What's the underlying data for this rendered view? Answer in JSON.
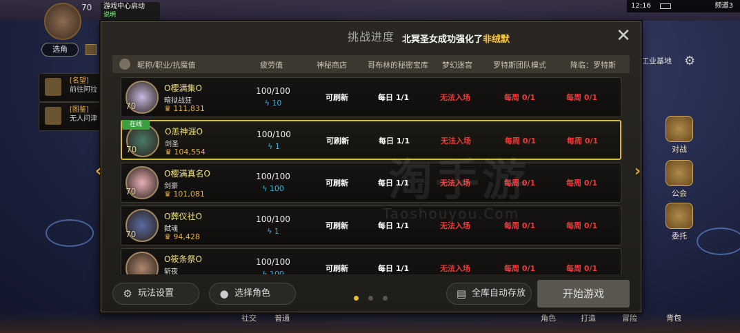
{
  "background": {
    "level": "70",
    "notice_title": "游戏中心启动",
    "notice_sub": "说明",
    "select_label": "选角",
    "side_items": [
      {
        "title": "[名望]",
        "desc": "前往阿拉"
      },
      {
        "title": "[图鉴]",
        "desc": "无人问津"
      }
    ],
    "status": {
      "time": "12:16",
      "channel": "频道3"
    },
    "area_label": "工业基地",
    "right_buttons": [
      "对战",
      "公会",
      "委托"
    ],
    "bottom_labels": [
      "社交",
      "普通",
      "角色",
      "打造",
      "冒险",
      "背包"
    ]
  },
  "modal": {
    "title": "挑战进度",
    "announcement_prefix": "北冥圣女成功强化了",
    "announcement_highlight": "非绒默",
    "columns": [
      "昵称/职业/抗魔值",
      "疲劳值",
      "神秘商店",
      "哥布林的秘密宝库",
      "梦幻迷宫",
      "罗特斯团队模式",
      "降临：罗特斯"
    ],
    "online_badge": "在线",
    "characters": [
      {
        "name": "O樱满集O",
        "job": "暗狱战狂",
        "power": "111,831",
        "level": "70",
        "fatigue": "100/100",
        "fatigue_bonus": "10",
        "shop": "可刷新",
        "goblin": "每日 1/1",
        "maze": "无法入场",
        "raid": "每周 0/1",
        "descent": "每周 0/1",
        "online": false,
        "avatar_color": "#c8b8e0"
      },
      {
        "name": "O恙神涯O",
        "job": "剑圣",
        "power": "104,554",
        "level": "70",
        "fatigue": "100/100",
        "fatigue_bonus": "1",
        "shop": "可刷新",
        "goblin": "每日 1/1",
        "maze": "无法入场",
        "raid": "每周 0/1",
        "descent": "每周 0/1",
        "online": true,
        "avatar_color": "#4a7a6a"
      },
      {
        "name": "O樱满真名O",
        "job": "剑豪",
        "power": "101,081",
        "level": "70",
        "fatigue": "100/100",
        "fatigue_bonus": "100",
        "shop": "可刷新",
        "goblin": "每日 1/1",
        "maze": "无法入场",
        "raid": "每周 0/1",
        "descent": "每周 0/1",
        "online": false,
        "avatar_color": "#e8b0b8"
      },
      {
        "name": "O葬仪社O",
        "job": "弑魂",
        "power": "94,428",
        "level": "70",
        "fatigue": "100/100",
        "fatigue_bonus": "1",
        "shop": "可刷新",
        "goblin": "每日 1/1",
        "maze": "无法入场",
        "raid": "每周 0/1",
        "descent": "每周 0/1",
        "online": false,
        "avatar_color": "#5a6aa0"
      },
      {
        "name": "O筱条祭O",
        "job": "斩夜",
        "power": "",
        "level": "",
        "fatigue": "100/100",
        "fatigue_bonus": "100",
        "shop": "可刷新",
        "goblin": "每日 1/1",
        "maze": "无法入场",
        "raid": "每周 0/1",
        "descent": "每周 0/1",
        "online": false,
        "avatar_color": "#b08870"
      }
    ],
    "footer": {
      "settings_label": "玩法设置",
      "select_role_label": "选择角色",
      "auto_store_label": "全库自动存放",
      "start_label": "开始游戏"
    },
    "watermark": "淘手游",
    "watermark_url": "Taoshouyou.Com"
  }
}
